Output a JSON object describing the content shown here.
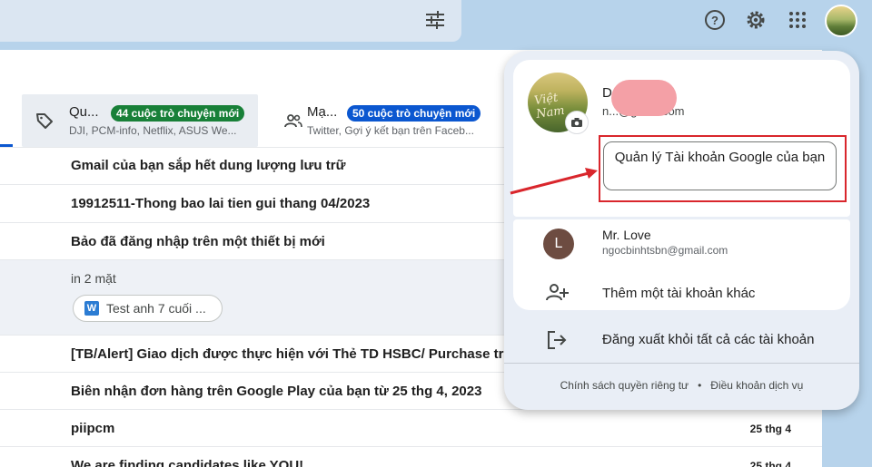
{
  "header": {
    "icons": [
      "tune-icon",
      "help-icon",
      "settings-icon",
      "apps-icon"
    ]
  },
  "tabs": [
    {
      "title": "Qu...",
      "badge": "44 cuộc trò chuyện mới",
      "subtitle": "DJI, PCM-info, Netflix, ASUS We...",
      "icon": "label-icon",
      "badge_color": "#188038"
    },
    {
      "title": "Mạ...",
      "badge": "50 cuộc trò chuyện mới",
      "subtitle": "Twitter, Gợi ý kết bạn trên Faceb...",
      "icon": "people-icon",
      "badge_color": "#0b57d0"
    }
  ],
  "emails": [
    {
      "subject": "Gmail của bạn sắp hết dung lượng lưu trữ",
      "date": ""
    },
    {
      "subject": "19912511-Thong bao lai tien gui thang 04/2023",
      "date": ""
    },
    {
      "subject": "Bảo đã đăng nhập trên một thiết bị mới",
      "date": ""
    },
    {
      "subject": "in 2 mặt",
      "attachment": "Test anh 7 cuối ...",
      "date": ""
    },
    {
      "subject": "[TB/Alert] Giao dịch được thực hiện với Thẻ TD HSBC/ Purchase tran",
      "date": ""
    },
    {
      "subject": "Biên nhận đơn hàng trên Google Play của bạn từ 25 thg 4, 2023",
      "date": ""
    },
    {
      "subject": "piipcm",
      "date": "25 thg 4"
    },
    {
      "subject": "We are finding candidates like YOU!",
      "date": "25 thg 4"
    }
  ],
  "account_popup": {
    "name_initial": "D",
    "email": "n...@gmail.com",
    "email_visible": "@gmail.com",
    "avatar_text": "Việt Nam",
    "manage_button": "Quản lý Tài khoản Google của bạn",
    "other_accounts": [
      {
        "initial": "L",
        "name": "Mr. Love",
        "email": "ngocbinhtsbn@gmail.com",
        "avatar_color": "#6d4c41"
      }
    ],
    "add_account": "Thêm một tài khoản khác",
    "sign_out": "Đăng xuất khỏi tất cả các tài khoản",
    "privacy": "Chính sách quyền riêng tư",
    "terms": "Điều khoản dịch vụ",
    "separator": "•"
  }
}
